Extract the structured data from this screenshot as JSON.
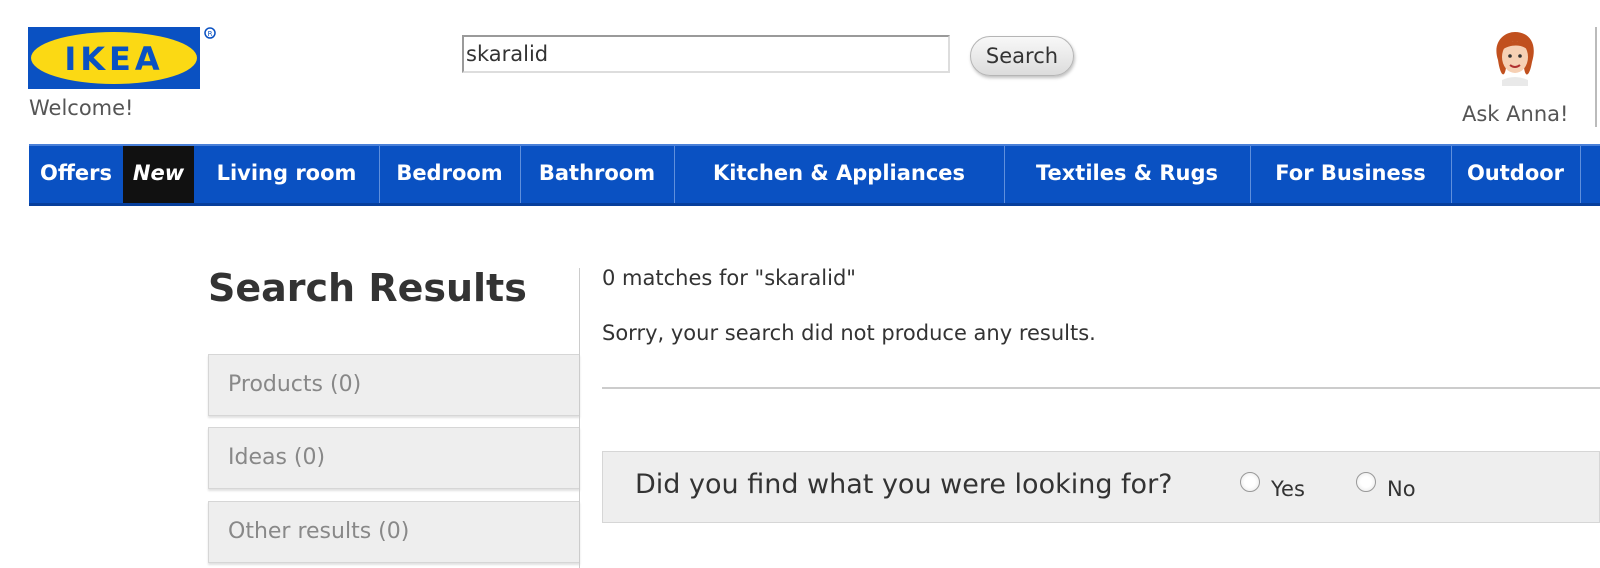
{
  "header": {
    "logo_text": "IKEA",
    "welcome": "Welcome!",
    "search": {
      "value": "skaralid",
      "button_label": "Search"
    },
    "ask_anna_label": "Ask Anna!"
  },
  "nav": {
    "items": [
      {
        "label": "Offers"
      },
      {
        "label": "New"
      },
      {
        "label": "Living room"
      },
      {
        "label": "Bedroom"
      },
      {
        "label": "Bathroom"
      },
      {
        "label": "Kitchen & Appliances"
      },
      {
        "label": "Textiles & Rugs"
      },
      {
        "label": "For Business"
      },
      {
        "label": "Outdoor"
      }
    ]
  },
  "results": {
    "title": "Search Results",
    "facets": [
      {
        "label": "Products (0)"
      },
      {
        "label": "Ideas (0)"
      },
      {
        "label": "Other results (0)"
      }
    ],
    "matches_text": "0 matches for \"skaralid\"",
    "no_results_text": "Sorry, your search did not produce any results."
  },
  "feedback": {
    "question": "Did you find what you were looking for?",
    "yes_label": "Yes",
    "no_label": "No"
  },
  "colors": {
    "brand_blue": "#0a51c2",
    "brand_yellow": "#fbd914",
    "new_tab_bg": "#111111",
    "facet_bg": "#eeeeee"
  },
  "icons": {
    "logo": "ikea-logo",
    "avatar": "anna-avatar-icon",
    "registered": "registered-mark-icon"
  }
}
